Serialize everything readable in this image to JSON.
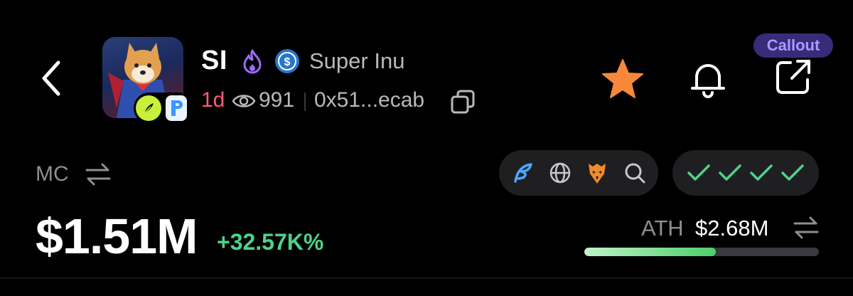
{
  "header": {
    "symbol": "SI",
    "name": "Super Inu",
    "age": "1d",
    "views": "991",
    "address": "0x51...ecab",
    "callout": "Callout",
    "icons": [
      "back-chevron-icon",
      "fire-icon",
      "usdc-icon",
      "eye-icon",
      "copy-icon",
      "star-icon",
      "bell-icon",
      "external-link-icon"
    ]
  },
  "market": {
    "mc_label": "MC",
    "mc_value": "$1.51M",
    "change": "+32.57K%",
    "ath_label": "ATH",
    "ath_value": "$2.68M",
    "ath_progress": 0.56
  },
  "links": {
    "icons": [
      "feather-icon",
      "globe-icon",
      "eagle-icon",
      "search-icon"
    ]
  },
  "checks": {
    "count": 4,
    "color": "#4ed28a"
  },
  "colors": {
    "accent_green": "#4ed28a",
    "age_pink": "#ff5b7a",
    "star_orange": "#f5883a",
    "callout_bg": "#3a2a7a",
    "callout_text": "#a99bff"
  }
}
